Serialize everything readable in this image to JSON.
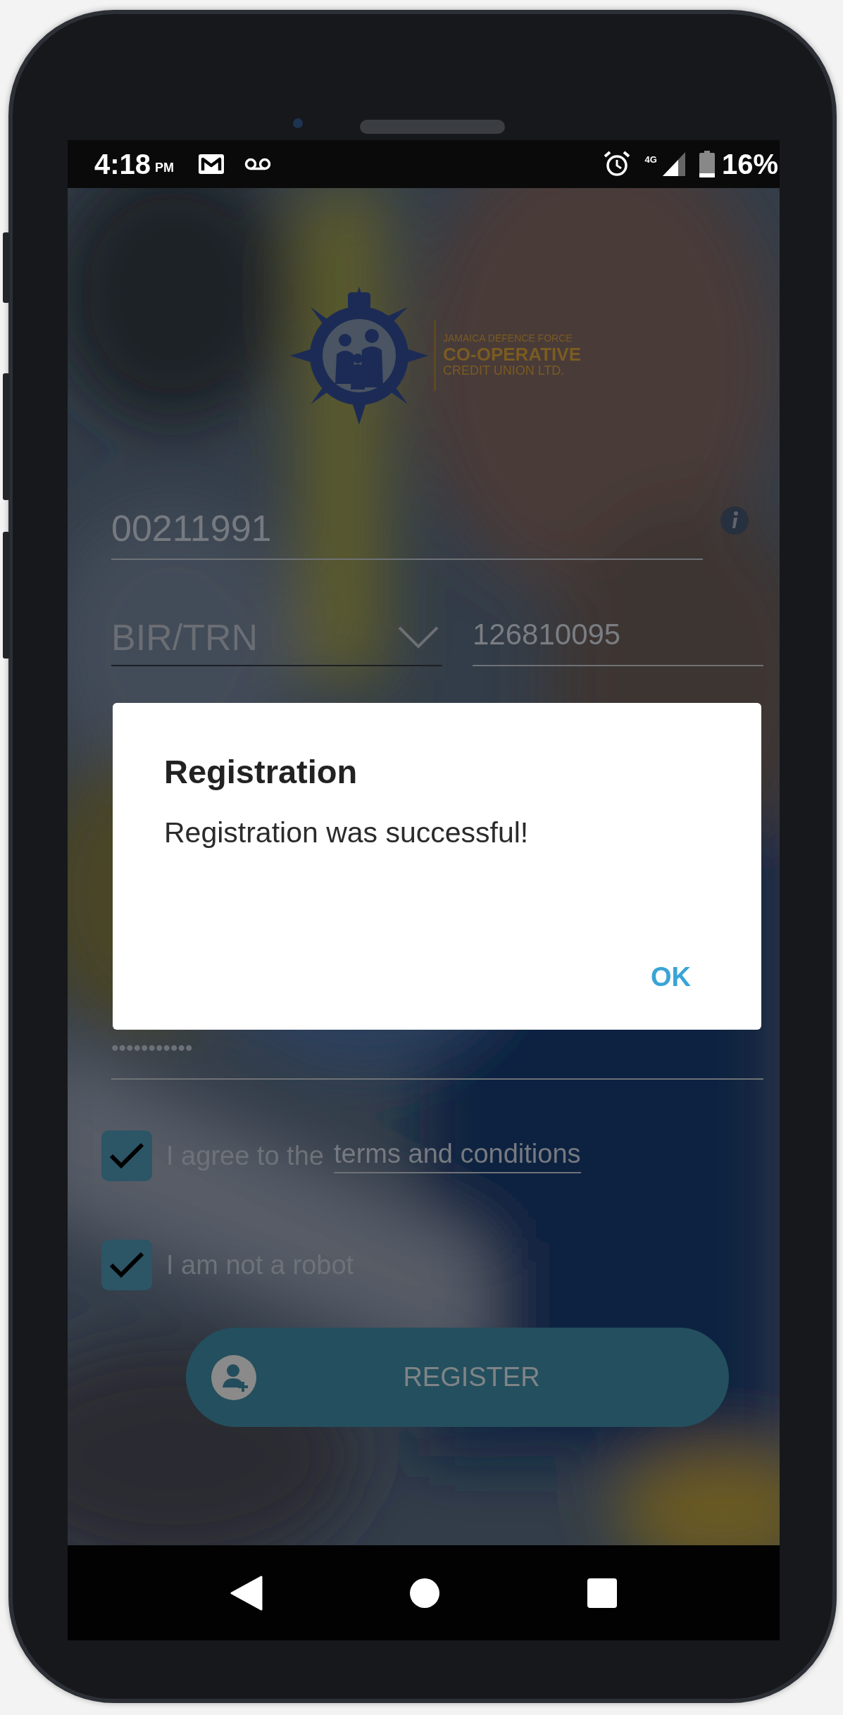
{
  "status_bar": {
    "time": "4:18",
    "time_suffix": "PM",
    "network": "4G",
    "battery": "16%"
  },
  "logo": {
    "lines": [
      "JAMAICA DEFENCE FORCE",
      "CO-OPERATIVE",
      "CREDIT UNION LTD."
    ]
  },
  "form": {
    "member_number": {
      "value": "00211991"
    },
    "id_type": {
      "value": "BIR/TRN"
    },
    "id_number": {
      "value": "126810095"
    },
    "password": {
      "value": "•••••••••••"
    }
  },
  "checkboxes": [
    {
      "label": "I agree to the",
      "link": "terms and conditions",
      "checked": true
    },
    {
      "label": "I am not a robot",
      "checked": true
    }
  ],
  "register_button": {
    "label": "REGISTER"
  },
  "dialog": {
    "title": "Registration",
    "message": "Registration was successful!",
    "buttons": [
      "OK"
    ]
  }
}
